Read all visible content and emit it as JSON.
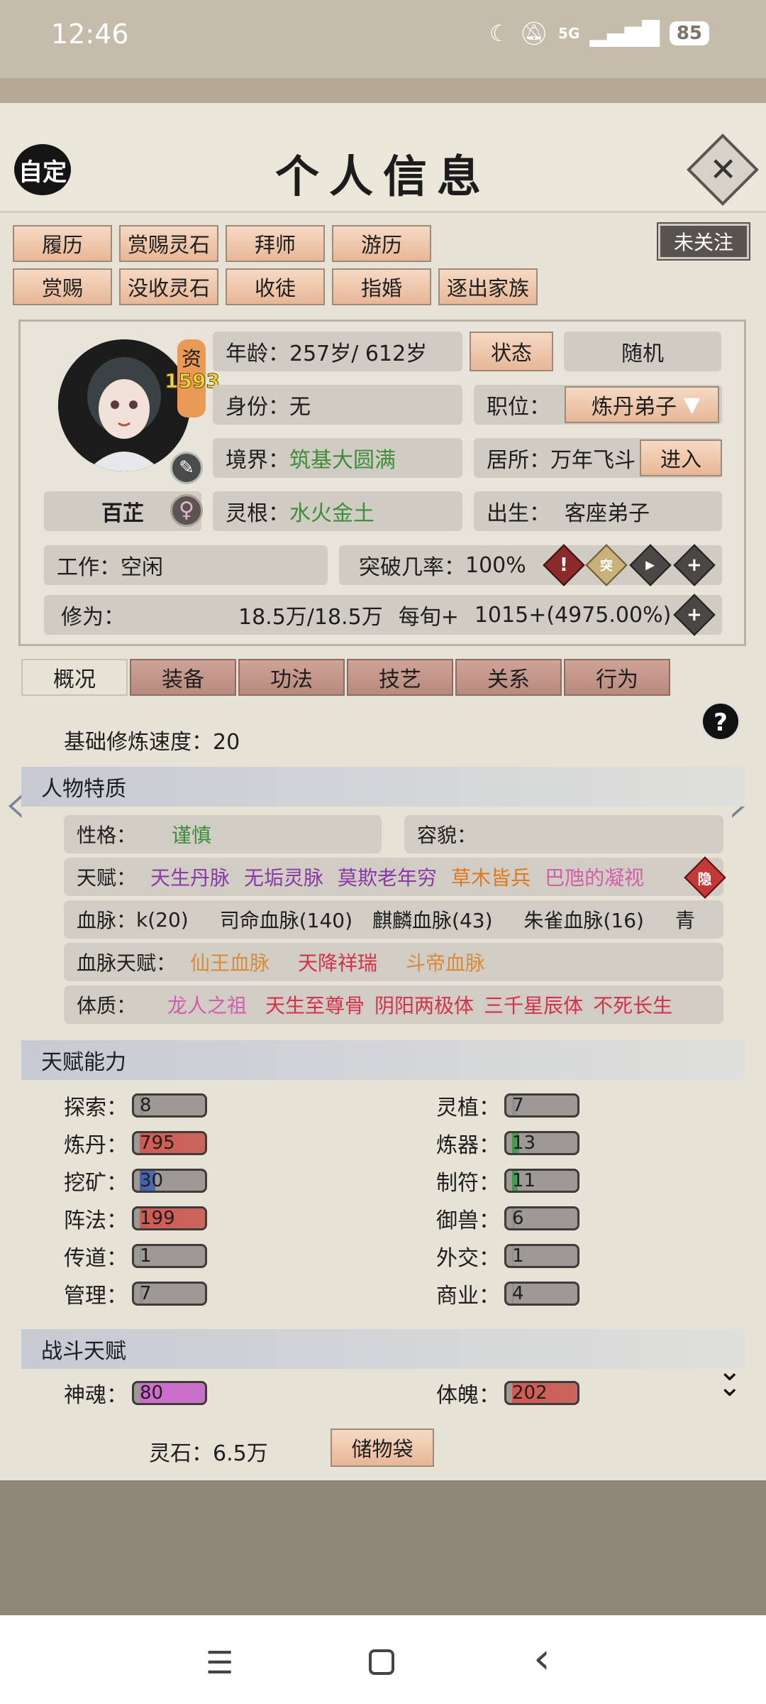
{
  "status_bar": {
    "time": "12:46",
    "battery": "85",
    "network": "5G"
  },
  "header": {
    "custom_label": "自定",
    "title": "个人信息",
    "close_icon": "close-icon"
  },
  "follow_label": "未关注",
  "actions_row1": [
    "履历",
    "赏赐灵石",
    "拜师",
    "游历"
  ],
  "actions_row2": [
    "赏赐",
    "没收灵石",
    "收徒",
    "指婚",
    "逐出家族"
  ],
  "profile": {
    "zi_label": "资",
    "zi_value": "1593",
    "name": "百芷",
    "gender_symbol": "♀",
    "age_label": "年龄：",
    "age_value": "257岁/ 612岁",
    "status_button": "状态",
    "random_button": "随机",
    "identity_label": "身份：",
    "identity_value": "无",
    "position_label": "职位：",
    "position_value": "炼丹弟子",
    "realm_label": "境界：",
    "realm_value": "筑基大圆满",
    "residence_label": "居所：",
    "residence_value": "万年飞斗",
    "enter_button": "进入",
    "root_label": "灵根：",
    "root_value": "水火金土",
    "birth_label": "出生：",
    "birth_value": "客座弟子",
    "work_label": "工作：",
    "work_value": "空闲",
    "breakthrough_label": "突破几率：",
    "breakthrough_value": "100%",
    "cultivation_label": "修为：",
    "cultivation_value": "18.5万/18.5万",
    "per_turn_label": "每旬+",
    "per_turn_value": "1015+(4975.00%)"
  },
  "tabs": [
    "概况",
    "装备",
    "功法",
    "技艺",
    "关系",
    "行为"
  ],
  "overview": {
    "base_speed_label": "基础修炼速度：",
    "base_speed_value": "20",
    "traits_title": "人物特质",
    "personality_label": "性格：",
    "personality_value": "谨慎",
    "appearance_label": "容貌：",
    "talent_label": "天赋：",
    "talents": [
      {
        "text": "天生丹脉",
        "color": "#8a3aa6"
      },
      {
        "text": "无垢灵脉",
        "color": "#8a3aa6"
      },
      {
        "text": "莫欺老年穷",
        "color": "#8a3aa6"
      },
      {
        "text": "草木皆兵",
        "color": "#e0781e"
      },
      {
        "text": "巴虺的凝视",
        "color": "#d45cad"
      }
    ],
    "hidden_badge": "隐",
    "bloodline_label": "血脉：",
    "bloodlines": [
      "k(20)",
      "司命血脉(140)",
      "麒麟血脉(43)",
      "朱雀血脉(16)",
      "青"
    ],
    "bloodline_talent_label": "血脉天赋：",
    "bloodline_talents": [
      {
        "text": "仙王血脉",
        "color": "#d98b3a"
      },
      {
        "text": "天降祥瑞",
        "color": "#d6304b"
      },
      {
        "text": "斗帝血脉",
        "color": "#d98b3a"
      }
    ],
    "physique_label": "体质：",
    "physiques": [
      {
        "text": "龙人之祖",
        "color": "#d45cad"
      },
      {
        "text": "天生至尊骨",
        "color": "#d6304b"
      },
      {
        "text": "阴阳两极体",
        "color": "#d6304b"
      },
      {
        "text": "三千星辰体",
        "color": "#d6304b"
      },
      {
        "text": "不死长生",
        "color": "#d6304b"
      }
    ],
    "abilities_title": "天赋能力",
    "abilities_left": [
      {
        "label": "探索：",
        "value": "8",
        "fill": 0.05,
        "color": "#8f8f8f"
      },
      {
        "label": "炼丹：",
        "value": "795",
        "fill": 1,
        "color": "#d25a52"
      },
      {
        "label": "挖矿：",
        "value": "30",
        "fill": 0.22,
        "color": "#3f5fb3"
      },
      {
        "label": "阵法：",
        "value": "199",
        "fill": 1,
        "color": "#d25a52"
      },
      {
        "label": "传道：",
        "value": "1",
        "fill": 0.02,
        "color": "#8f8f8f"
      },
      {
        "label": "管理：",
        "value": "7",
        "fill": 0.05,
        "color": "#8f8f8f"
      }
    ],
    "abilities_right": [
      {
        "label": "灵植：",
        "value": "7",
        "fill": 0.05,
        "color": "#8f8f8f"
      },
      {
        "label": "炼器：",
        "value": "13",
        "fill": 0.1,
        "color": "#3f9a4a"
      },
      {
        "label": "制符：",
        "value": "11",
        "fill": 0.08,
        "color": "#3f9a4a"
      },
      {
        "label": "御兽：",
        "value": "6",
        "fill": 0.04,
        "color": "#8f8f8f"
      },
      {
        "label": "外交：",
        "value": "1",
        "fill": 0.02,
        "color": "#8f8f8f"
      },
      {
        "label": "商业：",
        "value": "4",
        "fill": 0.03,
        "color": "#8f8f8f"
      }
    ],
    "combat_title": "战斗天赋",
    "combat": [
      {
        "label": "神魂：",
        "value": "80",
        "fill": 1,
        "color": "#d06ad2"
      },
      {
        "label": "体魄：",
        "value": "202",
        "fill": 1,
        "color": "#d25a52"
      }
    ]
  },
  "footer": {
    "spirit_stone_label": "灵石：",
    "spirit_stone_value": "6.5万",
    "storage_button": "储物袋"
  }
}
